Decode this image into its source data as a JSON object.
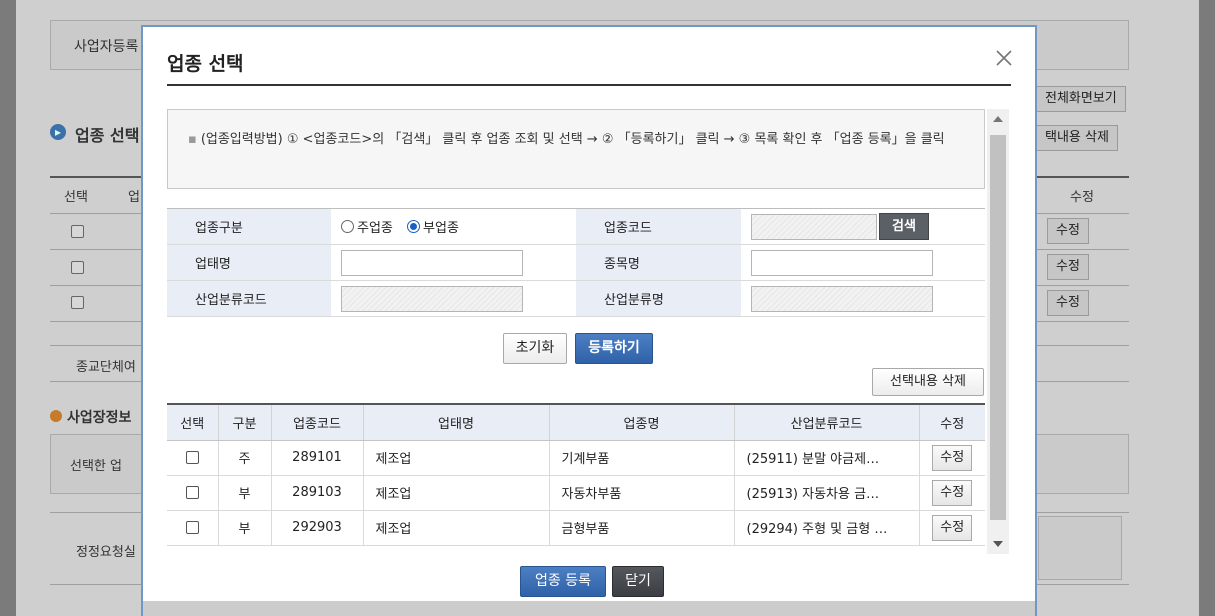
{
  "background": {
    "business_reg_label": "사업자등록",
    "section_title": "업종 선택",
    "full_screen_button": "전체화면보기",
    "delete_selected_button": "택내용 삭제",
    "col_select": "선택",
    "col_b": "업",
    "col_edit": "수정",
    "edit_label": "수정",
    "religion_label": "종교단체여",
    "site_info_title": "사업장정보",
    "selected_note": "선택한 업",
    "correction_label": "정정요청실"
  },
  "modal": {
    "title": "업종 선택",
    "notice": "(업종입력방법) ① <업종코드>의 「검색」 클릭 후 업종 조회 및 선택 → ② 「등록하기」 클릭 → ③ 목록 확인 후 「업종 등록」을 클릭",
    "form": {
      "category_label": "업종구분",
      "main_option": "주업종",
      "sub_option": "부업종",
      "selected_option": "부업종",
      "code_label": "업종코드",
      "search_button": "검색",
      "business_type_label": "업태명",
      "item_label": "종목명",
      "industry_code_label": "산업분류코드",
      "industry_name_label": "산업분류명"
    },
    "reset_button": "초기화",
    "register_button": "등록하기",
    "delete_selected_button": "선택내용 삭제",
    "table": {
      "headers": [
        "선택",
        "구분",
        "업종코드",
        "업태명",
        "업종명",
        "산업분류코드",
        "수정"
      ],
      "rows": [
        {
          "type": "주",
          "code": "289101",
          "business": "제조업",
          "item": "기계부품",
          "industry": "(25911) 분말 야금제…",
          "edit": "수정"
        },
        {
          "type": "부",
          "code": "289103",
          "business": "제조업",
          "item": "자동차부품",
          "industry": "(25913) 자동차용 금…",
          "edit": "수정"
        },
        {
          "type": "부",
          "code": "292903",
          "business": "제조업",
          "item": "금형부품",
          "industry": "(29294) 주형 및 금형 …",
          "edit": "수정"
        }
      ]
    },
    "submit_button": "업종 등록",
    "close_button": "닫기"
  },
  "colors": {
    "accent": "#2f62a8",
    "header_bg": "#e9eef6",
    "modal_border": "#6f98c8"
  }
}
